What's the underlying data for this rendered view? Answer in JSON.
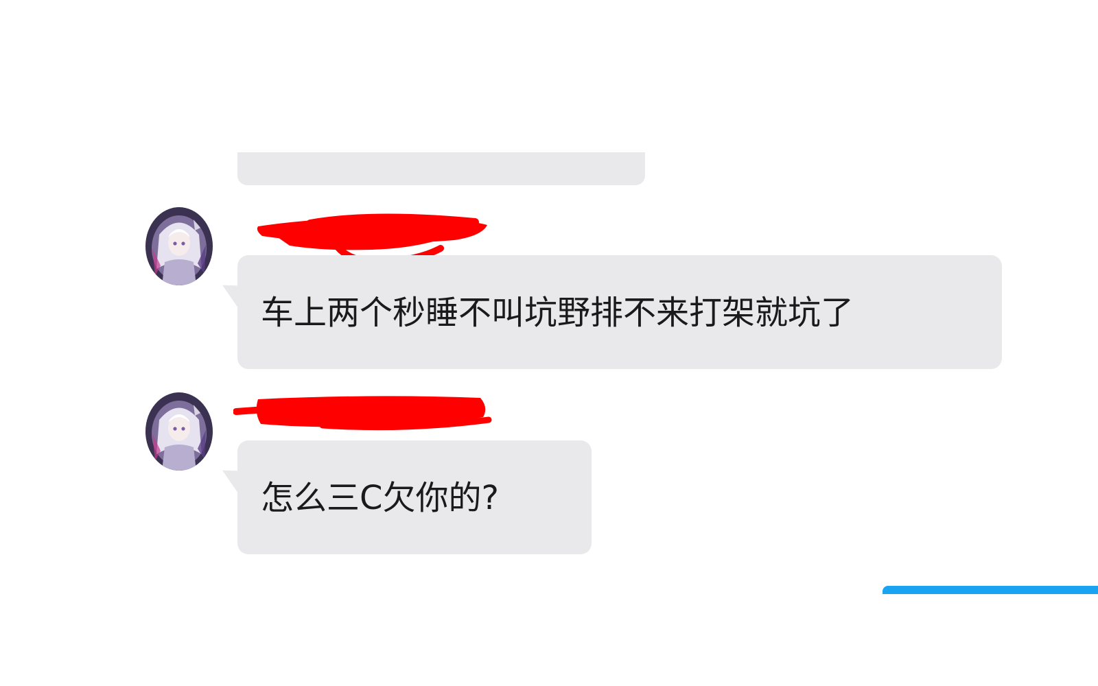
{
  "messages": [
    {
      "sender_name": "",
      "text": "车上两个秒睡不叫坑野排不来打架就坑了",
      "avatar_icon": "anime-character-avatar-icon"
    },
    {
      "sender_name": "",
      "text": "怎么三C欠你的?",
      "avatar_icon": "anime-character-avatar-icon"
    }
  ],
  "colors": {
    "bubble_bg": "#e9e9eb",
    "redaction": "#ff0000",
    "accent_bar": "#1aa3f0",
    "text": "#1a1a1a"
  }
}
